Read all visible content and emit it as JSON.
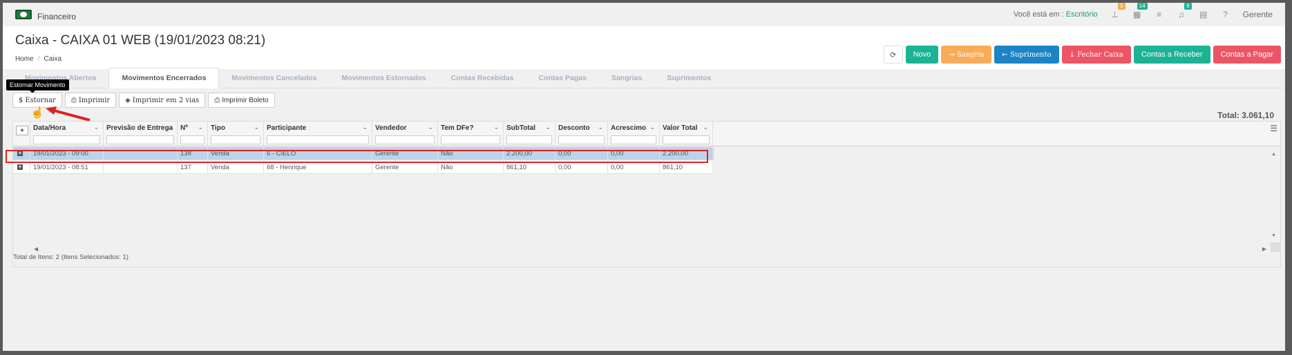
{
  "app": {
    "name": "Financeiro"
  },
  "topbar": {
    "location_label": "Você está em :",
    "location_value": "Escritório",
    "badges": {
      "tree": "5",
      "grid": "14",
      "bell": "9"
    },
    "user": "Gerente"
  },
  "header": {
    "title": "Caixa - CAIXA 01 WEB (19/01/2023 08:21)",
    "breadcrumb": [
      "Home",
      "Caixa"
    ]
  },
  "actions": {
    "novo": "Novo",
    "sangria": "Sangria",
    "suprimento": "Suprimento",
    "fechar": "Fechar Caixa",
    "receber": "Contas a Receber",
    "pagar": "Contas a Pagar"
  },
  "tabs": [
    {
      "label": "Movimentos Abertos"
    },
    {
      "label": "Movimentos Encerrados"
    },
    {
      "label": "Movimentos Cancelados"
    },
    {
      "label": "Movimentos Estornados"
    },
    {
      "label": "Contas Recebidas"
    },
    {
      "label": "Contas Pagas"
    },
    {
      "label": "Sangrias"
    },
    {
      "label": "Suprimentos"
    }
  ],
  "tooltip": "Estornar Movimento",
  "toolbar": {
    "estornar": "Estornar",
    "imprimir": "Imprimir",
    "imprimir2": "Imprimir em 2 vias",
    "boleto": "Imprimir Boleto"
  },
  "total": "Total: 3.061,10",
  "columns": [
    "Data/Hora",
    "Previsão de Entrega",
    "Nº",
    "Tipo",
    "Participante",
    "Vendedor",
    "Tem DFe?",
    "SubTotal",
    "Desconto",
    "Acrescimo",
    "Valor Total"
  ],
  "rows": [
    [
      "19/01/2023 - 09:00",
      "",
      "138",
      "Venda",
      "6 - CIELO",
      "Gerente",
      "Não",
      "2.200,00",
      "0,00",
      "0,00",
      "2.200,00"
    ],
    [
      "19/01/2023 - 08:51",
      "",
      "137",
      "Venda",
      "68 - Henrique",
      "Gerente",
      "Não",
      "861,10",
      "0,00",
      "0,00",
      "861,10"
    ]
  ],
  "footer": "Total de Itens: 2 (Itens Selecionados: 1)"
}
